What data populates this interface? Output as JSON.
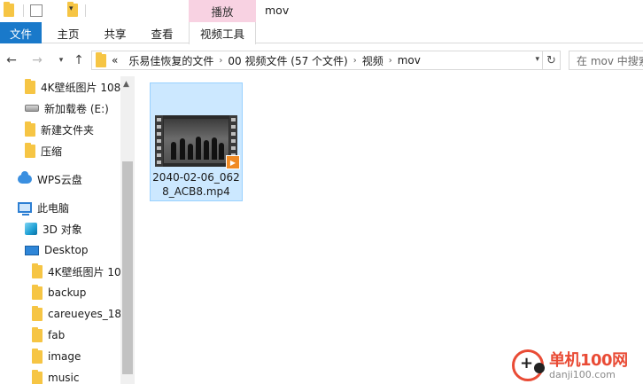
{
  "titlebar": {
    "context_tab": "播放",
    "window_title": "mov"
  },
  "ribbon": {
    "tabs": [
      {
        "label": "文件"
      },
      {
        "label": "主页"
      },
      {
        "label": "共享"
      },
      {
        "label": "查看"
      },
      {
        "label": "视频工具"
      }
    ]
  },
  "address": {
    "overflow": "«",
    "crumbs": [
      "乐易佳恢复的文件",
      "00 视频文件 (57 个文件)",
      "视频",
      "mov"
    ],
    "separator": "›"
  },
  "search": {
    "placeholder": "在 mov 中搜索"
  },
  "navpane": {
    "items": [
      {
        "label": "4K壁纸图片 108",
        "icon": "folder-icon"
      },
      {
        "label": "新加载卷 (E:)",
        "icon": "drive-icon"
      },
      {
        "label": "新建文件夹",
        "icon": "folder-icon"
      },
      {
        "label": "压缩",
        "icon": "folder-icon"
      },
      {
        "label": "WPS云盘",
        "icon": "cloud-icon"
      },
      {
        "label": "此电脑",
        "icon": "computer-icon"
      },
      {
        "label": "3D 对象",
        "icon": "3d-objects-icon"
      },
      {
        "label": "Desktop",
        "icon": "desktop-icon"
      },
      {
        "label": "4K壁纸图片 10",
        "icon": "folder-icon"
      },
      {
        "label": "backup",
        "icon": "folder-icon"
      },
      {
        "label": "careueyes_18",
        "icon": "folder-icon"
      },
      {
        "label": "fab",
        "icon": "folder-icon"
      },
      {
        "label": "image",
        "icon": "folder-icon"
      },
      {
        "label": "music",
        "icon": "folder-icon"
      }
    ]
  },
  "content": {
    "files": [
      {
        "name": "2040-02-06_0628_ACB8.mp4",
        "icon": "video-file-icon",
        "selected": true
      }
    ]
  },
  "watermark": {
    "title": "单机100网",
    "url": "danji100.com"
  },
  "colors": {
    "file_tab": "#1979ca",
    "context_tab": "#f8d2e2",
    "selection": "#cce8ff",
    "folder": "#f6c544"
  }
}
